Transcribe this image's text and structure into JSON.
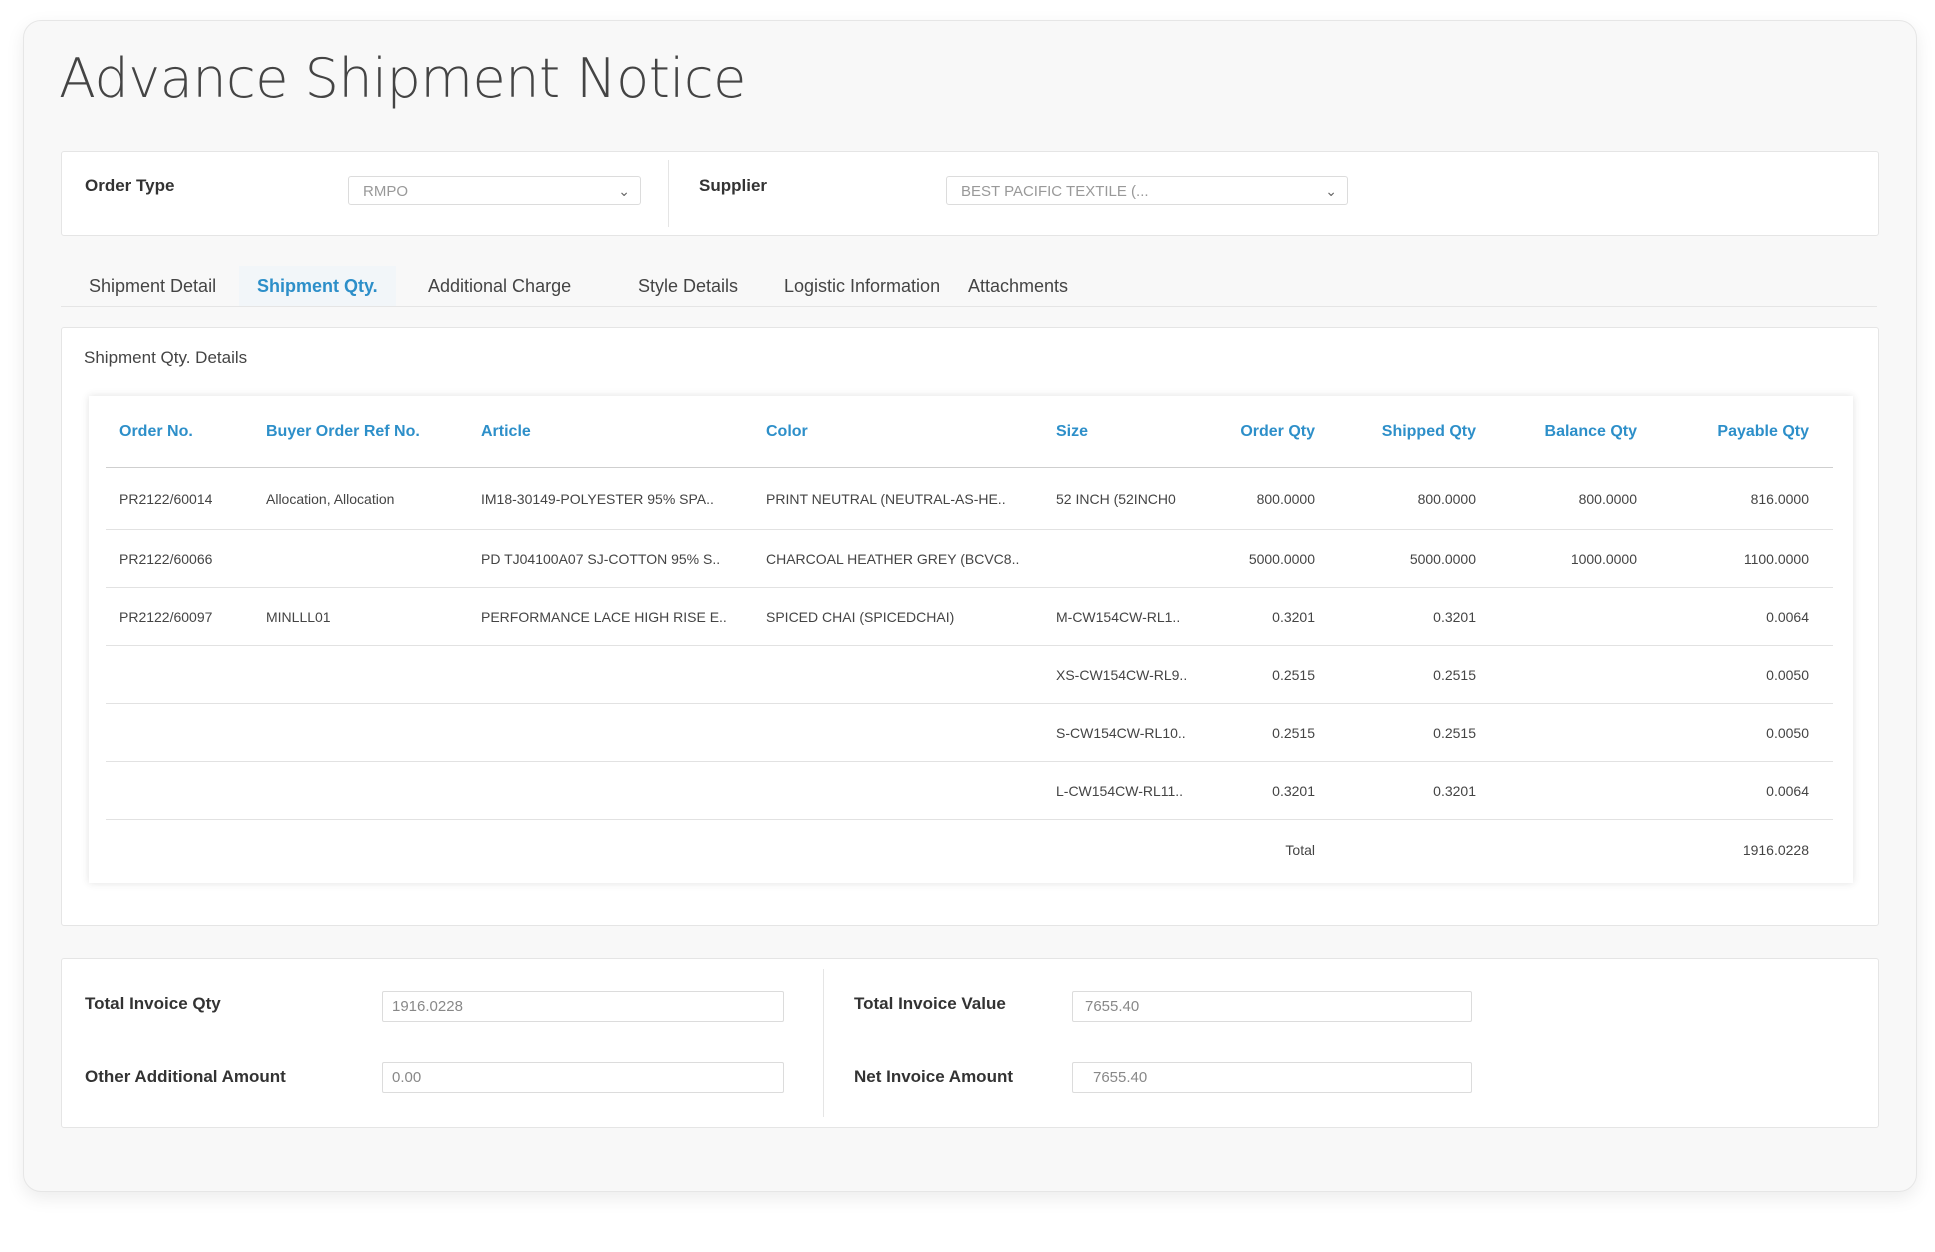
{
  "page": {
    "title": "Advance Shipment Notice"
  },
  "filters": {
    "order_type_label": "Order Type",
    "order_type_value": "RMPO",
    "supplier_label": "Supplier",
    "supplier_value": "BEST PACIFIC TEXTILE (..."
  },
  "tabs": [
    {
      "label": "Shipment Detail"
    },
    {
      "label": "Shipment Qty.",
      "active": true
    },
    {
      "label": "Additional Charge"
    },
    {
      "label": "Style Details"
    },
    {
      "label": "Logistic Information"
    },
    {
      "label": "Attachments"
    }
  ],
  "details": {
    "title": "Shipment Qty. Details",
    "columns": [
      "Order No.",
      "Buyer Order Ref No.",
      "Article",
      "Color",
      "Size",
      "Order Qty",
      "Shipped  Qty",
      "Balance  Qty",
      "Payable  Qty"
    ],
    "rows": [
      [
        "PR2122/60014",
        "Allocation, Allocation",
        "IM18-30149-POLYESTER 95% SPA..",
        "PRINT NEUTRAL (NEUTRAL-AS-HE..",
        "52 INCH (52INCH0",
        "800.0000",
        "800.0000",
        "800.0000",
        "816.0000"
      ],
      [
        "PR2122/60066",
        "",
        "PD TJ04100A07 SJ-COTTON 95% S..",
        "CHARCOAL HEATHER GREY (BCVC8..",
        "",
        "5000.0000",
        "5000.0000",
        "1000.0000",
        "1100.0000"
      ],
      [
        "PR2122/60097",
        "MINLLL01",
        "PERFORMANCE LACE HIGH RISE E..",
        "SPICED CHAI (SPICEDCHAI)",
        "M-CW154CW-RL1..",
        "0.3201",
        "0.3201",
        "",
        "0.0064"
      ],
      [
        "",
        "",
        "",
        "",
        "XS-CW154CW-RL9..",
        "0.2515",
        "0.2515",
        "",
        "0.0050"
      ],
      [
        "",
        "",
        "",
        "",
        "S-CW154CW-RL10..",
        "0.2515",
        "0.2515",
        "",
        "0.0050"
      ],
      [
        "",
        "",
        "",
        "",
        "L-CW154CW-RL11..",
        "0.3201",
        "0.3201",
        "",
        "0.0064"
      ]
    ],
    "total_label": "Total",
    "total_value": "1916.0228"
  },
  "summary": {
    "total_invoice_qty_label": "Total Invoice Qty",
    "total_invoice_qty_value": "1916.0228",
    "other_additional_amount_label": "Other Additional Amount",
    "other_additional_amount_value": "0.00",
    "total_invoice_value_label": "Total Invoice Value",
    "total_invoice_value_value": "7655.40",
    "net_invoice_amount_label": "Net Invoice Amount",
    "net_invoice_amount_value": "7655.40"
  }
}
